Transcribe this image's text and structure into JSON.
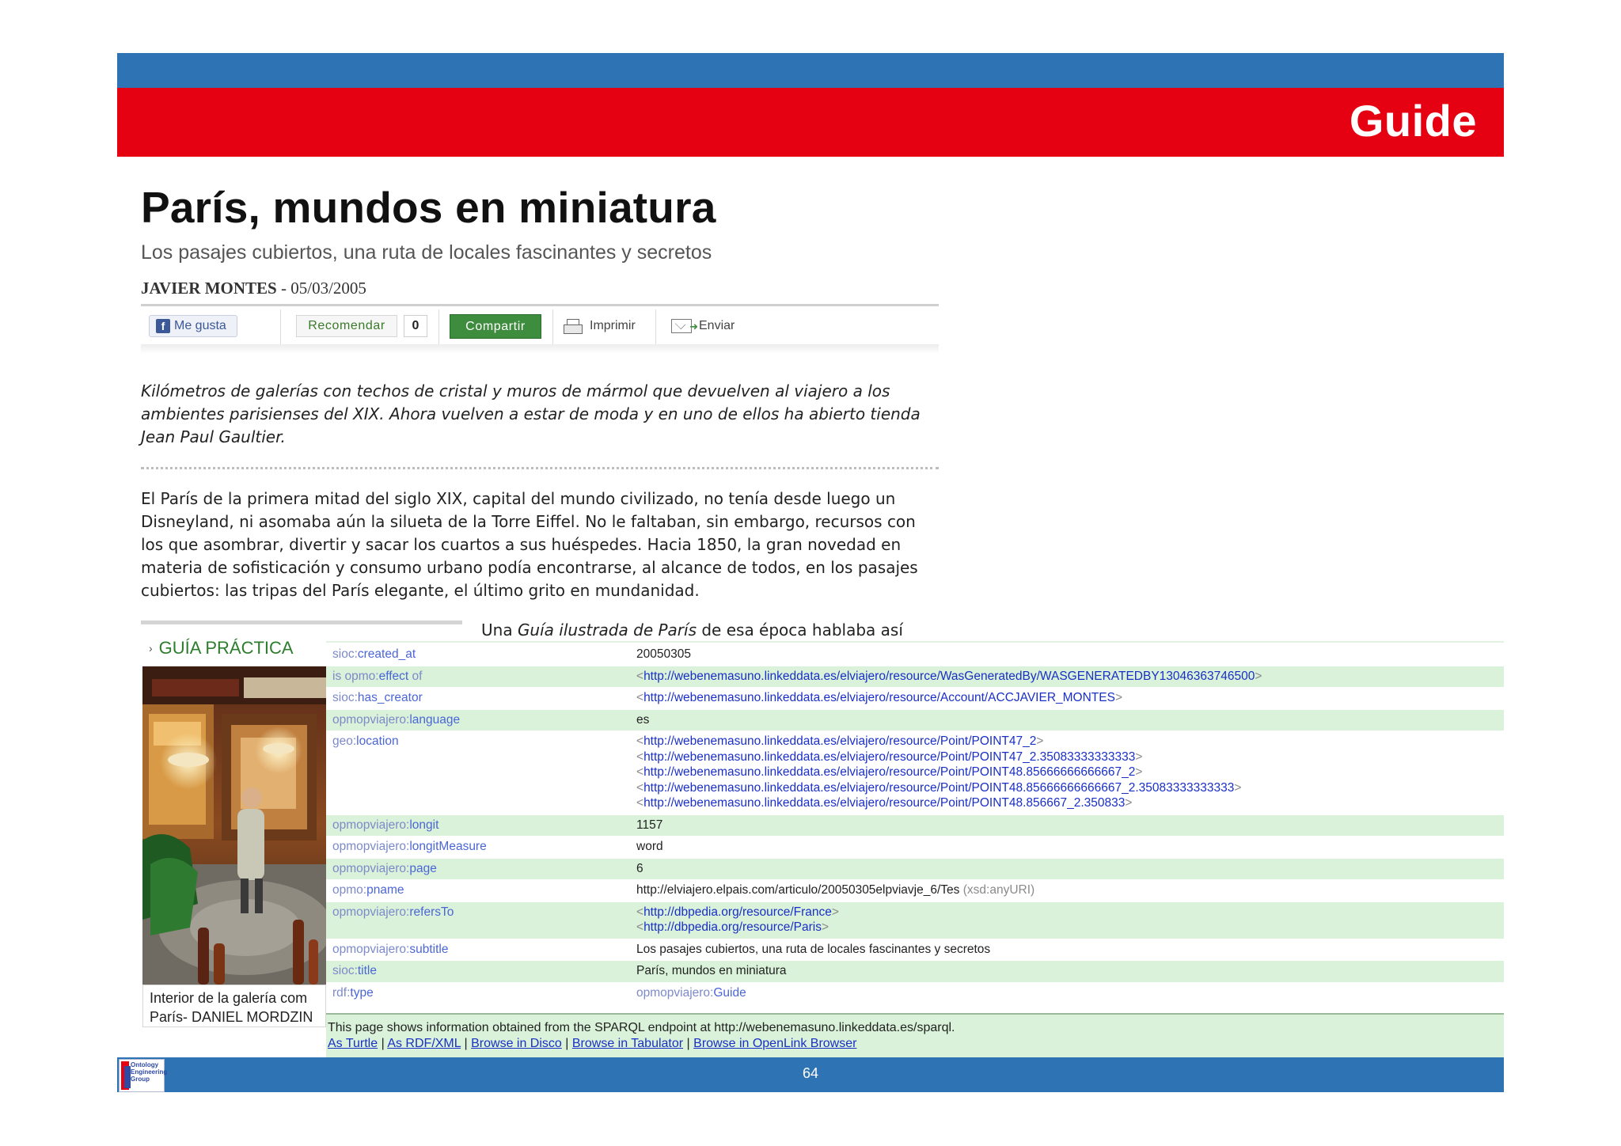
{
  "slide": {
    "title": "Guide",
    "page_number": "64",
    "logo_text": "Ontology Engineering Group"
  },
  "article": {
    "title": "París, mundos en miniatura",
    "subtitle": "Los pasajes cubiertos, una ruta de locales fascinantes y secretos",
    "author": "JAVIER MONTES",
    "date_sep": " - ",
    "date": "05/03/2005",
    "share": {
      "facebook_label": "Me gusta",
      "recommend_label": "Recomendar",
      "recommend_count": "0",
      "share_label": "Compartir",
      "print_label": "Imprimir",
      "send_label": "Enviar"
    },
    "lead": "Kilómetros de galerías con techos de cristal y muros de mármol que devuelven al viajero a los ambientes parisienses del XIX. Ahora vuelven a estar de moda y en uno de ellos ha abierto tienda Jean Paul Gaultier.",
    "body": "El París de la primera mitad del siglo XIX, capital del mundo civilizado, no tenía desde luego un Disneyland, ni asomaba aún la silueta de la Torre Eiffel. No le faltaban, sin embargo, recursos con los que asombrar, divertir y sacar los cuartos a sus huéspedes. Hacia 1850, la gran novedad en materia de sofisticación y consumo urbano podía encontrarse, al alcance de todos, en los pasajes cubiertos: las tripas del París elegante, el último grito en mundanidad.",
    "continuation_before": "Una ",
    "continuation_italic": "Guía ilustrada de París",
    "continuation_after": " de esa época hablaba así",
    "guide_box": {
      "title": "GUÍA PRÁCTICA",
      "caption_line1": "Interior de la galería com",
      "caption_line2": "París- DANIEL MORDZIN"
    }
  },
  "rdf": {
    "rows": [
      {
        "ns": "sioc:",
        "pred": "created_at",
        "objects": [
          {
            "kind": "literal",
            "text": "20050305"
          }
        ]
      },
      {
        "ns": "is opmo:",
        "pred": "effect",
        "pred_suffix": " of",
        "objects": [
          {
            "kind": "uri",
            "text": "http://webenemasuno.linkeddata.es/elviajero/resource/WasGeneratedBy/WASGENERATEDBY13046363746500"
          }
        ]
      },
      {
        "ns": "sioc:",
        "pred": "has_creator",
        "objects": [
          {
            "kind": "uri",
            "text": "http://webenemasuno.linkeddata.es/elviajero/resource/Account/ACCJAVIER_MONTES"
          }
        ]
      },
      {
        "ns": "opmopviajero:",
        "pred": "language",
        "objects": [
          {
            "kind": "literal",
            "text": "es"
          }
        ]
      },
      {
        "ns": "geo:",
        "pred": "location",
        "objects": [
          {
            "kind": "uri",
            "text": "http://webenemasuno.linkeddata.es/elviajero/resource/Point/POINT47_2"
          },
          {
            "kind": "uri",
            "text": "http://webenemasuno.linkeddata.es/elviajero/resource/Point/POINT47_2.35083333333333"
          },
          {
            "kind": "uri",
            "text": "http://webenemasuno.linkeddata.es/elviajero/resource/Point/POINT48.85666666666667_2"
          },
          {
            "kind": "uri",
            "text": "http://webenemasuno.linkeddata.es/elviajero/resource/Point/POINT48.85666666666667_2.35083333333333"
          },
          {
            "kind": "uri",
            "text": "http://webenemasuno.linkeddata.es/elviajero/resource/Point/POINT48.856667_2.350833"
          }
        ]
      },
      {
        "ns": "opmopviajero:",
        "pred": "longit",
        "objects": [
          {
            "kind": "literal",
            "text": "1157"
          }
        ]
      },
      {
        "ns": "opmopviajero:",
        "pred": "longitMeasure",
        "objects": [
          {
            "kind": "literal",
            "text": "word"
          }
        ]
      },
      {
        "ns": "opmopviajero:",
        "pred": "page",
        "objects": [
          {
            "kind": "literal",
            "text": "6"
          }
        ]
      },
      {
        "ns": "opmo:",
        "pred": "pname",
        "objects": [
          {
            "kind": "typed",
            "text": "http://elviajero.elpais.com/articulo/20050305elpviavje_6/Tes",
            "datatype": "(xsd:anyURI)"
          }
        ]
      },
      {
        "ns": "opmopviajero:",
        "pred": "refersTo",
        "objects": [
          {
            "kind": "uri",
            "text": "http://dbpedia.org/resource/France"
          },
          {
            "kind": "uri",
            "text": "http://dbpedia.org/resource/Paris"
          }
        ]
      },
      {
        "ns": "opmopviajero:",
        "pred": "subtitle",
        "objects": [
          {
            "kind": "literal",
            "text": "Los pasajes cubiertos, una ruta de locales fascinantes y secretos"
          }
        ]
      },
      {
        "ns": "sioc:",
        "pred": "title",
        "objects": [
          {
            "kind": "literal",
            "text": "París, mundos en miniatura"
          }
        ]
      },
      {
        "ns": "rdf:",
        "pred": "type",
        "objects": [
          {
            "kind": "qname",
            "ns": "opmopviajero:",
            "text": "Guide"
          }
        ]
      }
    ],
    "footer_note": "This page shows information obtained from the SPARQL endpoint at http://webenemasuno.linkeddata.es/sparql.",
    "footer_links": [
      "As Turtle",
      "As RDF/XML",
      "Browse in Disco",
      "Browse in Tabulator",
      "Browse in OpenLink Browser"
    ],
    "footer_separator": " | "
  },
  "colors": {
    "header_blue": "#2e74b5",
    "header_red": "#e50012",
    "row_green": "#d9f2d9",
    "link_blue": "#1a2fc7",
    "guide_green": "#2e7d2e"
  }
}
